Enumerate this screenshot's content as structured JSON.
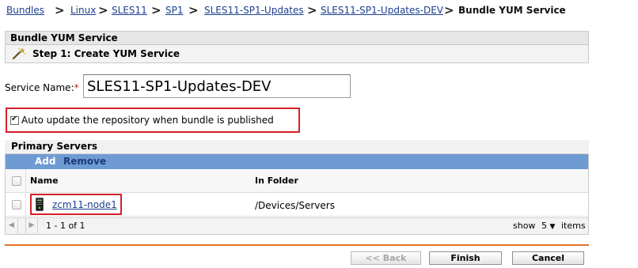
{
  "breadcrumb": {
    "items": [
      "Bundles",
      "Linux",
      "SLES11",
      "SP1",
      "SLES11-SP1-Updates",
      "SLES11-SP1-Updates-DEV"
    ],
    "separator": ">",
    "current": "Bundle YUM Service"
  },
  "wizard": {
    "title": "Bundle YUM Service",
    "step": "Step 1: Create YUM Service"
  },
  "form": {
    "service_name_label": "Service Name:",
    "required_mark": "*",
    "service_name_value": "SLES11-SP1-Updates-DEV",
    "auto_update_label": "Auto update the repository when bundle is published",
    "auto_update_checked": true
  },
  "primary_servers": {
    "title": "Primary Servers",
    "toolbar": {
      "add": "Add",
      "remove": "Remove"
    },
    "columns": [
      "Name",
      "In Folder"
    ],
    "rows": [
      {
        "name": "zcm11-node1",
        "folder": "/Devices/Servers"
      }
    ],
    "pager": {
      "range": "1 - 1 of 1",
      "show_label": "show",
      "page_size": "5",
      "items_label": "items"
    }
  },
  "footer": {
    "back": "<< Back",
    "finish": "Finish",
    "cancel": "Cancel"
  },
  "colors": {
    "accent_orange": "#e2732a",
    "toolbar_blue": "#6f9bd3",
    "highlight_red": "#d4202a",
    "link_blue": "#1d3f8f"
  }
}
